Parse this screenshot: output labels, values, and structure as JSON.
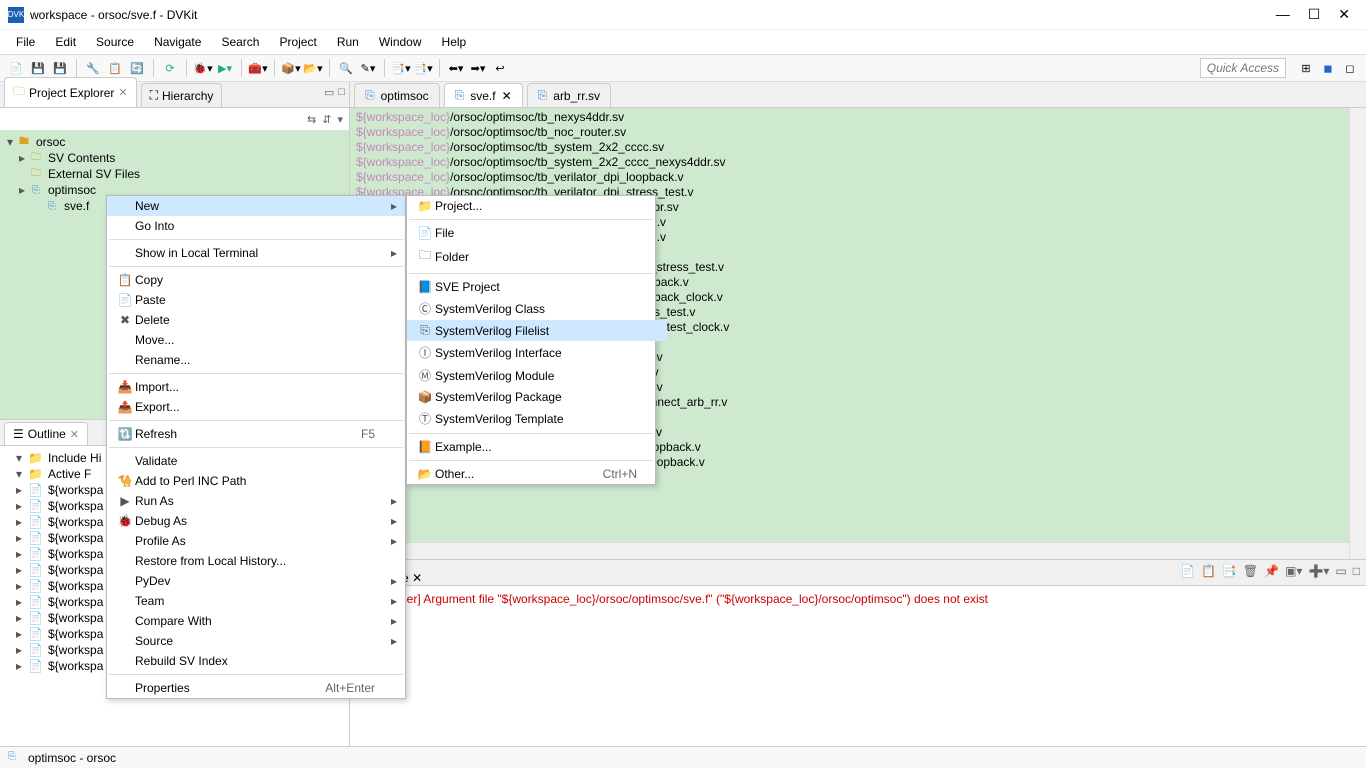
{
  "window": {
    "title": "workspace - orsoc/sve.f - DVKit",
    "app_badge": "DVK"
  },
  "menubar": [
    "File",
    "Edit",
    "Source",
    "Navigate",
    "Search",
    "Project",
    "Run",
    "Window",
    "Help"
  ],
  "quick_access": "Quick Access",
  "views": {
    "project_explorer": {
      "label": "Project Explorer",
      "active": true
    },
    "hierarchy": {
      "label": "Hierarchy"
    }
  },
  "tree": {
    "root": {
      "name": "orsoc"
    },
    "children": [
      {
        "name": "SV Contents",
        "kind": "folder"
      },
      {
        "name": "External SV Files",
        "kind": "folder"
      },
      {
        "name": "optimsoc",
        "kind": "filelist"
      },
      {
        "name": "sve.f",
        "kind": "filelist"
      }
    ]
  },
  "outline": {
    "label": "Outline",
    "rows": [
      "Include Hi",
      "Active F",
      "${workspa",
      "${workspa",
      "${workspa",
      "${workspa",
      "${workspa",
      "${workspa",
      "${workspa",
      "${workspa",
      "${workspa",
      "${workspa",
      "${workspa",
      "${workspa"
    ]
  },
  "editor": {
    "tabs": [
      {
        "name": "optimsoc",
        "active": false
      },
      {
        "name": "sve.f",
        "active": true,
        "closable": true
      },
      {
        "name": "arb_rr.sv",
        "active": false
      }
    ],
    "var": "${workspace_loc}",
    "lines_full": [
      "/orsoc/optimsoc/tb_nexys4ddr.sv",
      "/orsoc/optimsoc/tb_noc_router.sv",
      "/orsoc/optimsoc/tb_system_2x2_cccc.sv",
      "/orsoc/optimsoc/tb_system_2x2_cccc_nexys4ddr.sv",
      "/orsoc/optimsoc/tb_verilator_dpi_loopback.v",
      "/orsoc/optimsoc/tb_verilator_dpi_stress_test.v"
    ],
    "lines_partial": [
      "onitor.sv",
      "l_01.v",
      "l_02.v",
      ".v",
      "fx3_stress_test.v",
      "oopback.v",
      "oopback_clock.v",
      "tress_test.v",
      "tress_test_clock.v",
      ".sv",
      "03.sv",
      "el.sv",
      "de.sv",
      "rconnect_arb_rr.v",
      ".v",
      "sp.sv",
      "j_loopback.v",
      "3_loopback.v"
    ]
  },
  "console": {
    "label": "Console",
    "text": "gFileParser] Argument file \"${workspace_loc}/orsoc/optimsoc/sve.f\" (\"${workspace_loc}/orsoc/optimsoc\") does not exist"
  },
  "statusbar": {
    "text": "optimsoc - orsoc"
  },
  "ctx_main": [
    {
      "label": "New",
      "arrow": true,
      "sel": true
    },
    {
      "label": "Go Into"
    },
    {
      "sep": true
    },
    {
      "label": "Show in Local Terminal",
      "arrow": true
    },
    {
      "sep": true
    },
    {
      "label": "Copy",
      "icon": "copy"
    },
    {
      "label": "Paste",
      "icon": "paste"
    },
    {
      "label": "Delete",
      "icon": "delete"
    },
    {
      "label": "Move..."
    },
    {
      "label": "Rename..."
    },
    {
      "sep": true
    },
    {
      "label": "Import...",
      "icon": "import"
    },
    {
      "label": "Export...",
      "icon": "export"
    },
    {
      "sep": true
    },
    {
      "label": "Refresh",
      "icon": "refresh",
      "key": "F5"
    },
    {
      "sep": true
    },
    {
      "label": "Validate"
    },
    {
      "label": "Add to Perl INC Path",
      "icon": "perl"
    },
    {
      "label": "Run As",
      "icon": "run",
      "arrow": true
    },
    {
      "label": "Debug As",
      "icon": "debug",
      "arrow": true
    },
    {
      "label": "Profile As",
      "arrow": true
    },
    {
      "label": "Restore from Local History..."
    },
    {
      "label": "PyDev",
      "arrow": true
    },
    {
      "label": "Team",
      "arrow": true
    },
    {
      "label": "Compare With",
      "arrow": true
    },
    {
      "label": "Source",
      "arrow": true
    },
    {
      "label": "Rebuild SV Index"
    },
    {
      "sep": true
    },
    {
      "label": "Properties",
      "key": "Alt+Enter"
    }
  ],
  "ctx_new": [
    {
      "label": "Project...",
      "icon": "proj"
    },
    {
      "sep": true
    },
    {
      "label": "File",
      "icon": "file"
    },
    {
      "label": "Folder",
      "icon": "folder"
    },
    {
      "sep": true
    },
    {
      "label": "SVE Project",
      "icon": "sve"
    },
    {
      "label": "SystemVerilog Class",
      "icon": "class"
    },
    {
      "label": "SystemVerilog Filelist",
      "icon": "filelist",
      "sel": true
    },
    {
      "label": "SystemVerilog Interface",
      "icon": "iface"
    },
    {
      "label": "SystemVerilog Module",
      "icon": "module"
    },
    {
      "label": "SystemVerilog Package",
      "icon": "package"
    },
    {
      "label": "SystemVerilog Template",
      "icon": "template"
    },
    {
      "sep": true
    },
    {
      "label": "Example...",
      "icon": "example"
    },
    {
      "sep": true
    },
    {
      "label": "Other...",
      "icon": "other",
      "key": "Ctrl+N"
    }
  ]
}
